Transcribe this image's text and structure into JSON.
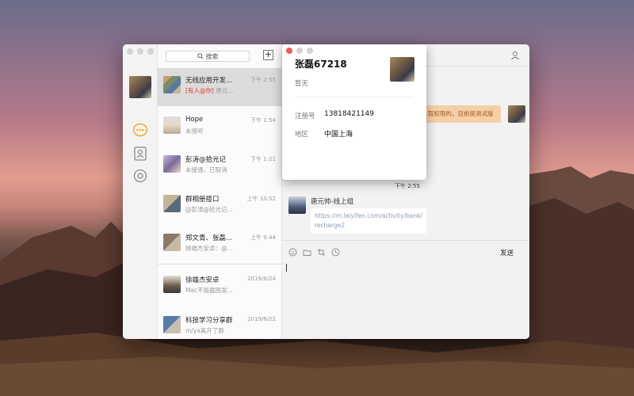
{
  "conversations": {
    "search_placeholder": "搜索",
    "add_label": "+",
    "items": [
      {
        "name": "无线应用开发...",
        "time": "下午 2:55",
        "mention": "[有人@你]",
        "preview": "唐元...",
        "selected": true
      },
      {
        "name": "Hope",
        "time": "下午 1:54",
        "preview": "未接听"
      },
      {
        "name": "彭涛@拾光记",
        "time": "下午 1:21",
        "preview": "未接通，已取消"
      },
      {
        "name": "群相册接口",
        "time": "上午 10:52",
        "preview": "@彭涛@拾光记..."
      },
      {
        "name": "郑文青、张磊...",
        "time": "上午 9:44",
        "preview": "徐雄杰安卓：@..."
      },
      {
        "name": "徐雄杰安卓",
        "time": "2019/6/24",
        "preview": "Mac不能截图发..."
      },
      {
        "name": "科技学习分享群",
        "time": "2019/6/22",
        "preview": "m/ya离开了群"
      }
    ]
  },
  "chat": {
    "orange_bubble": "取权限的，目前是测试版",
    "timestamp": "下午 2:55",
    "sender_name": "唐元帅-线上组",
    "link_text": "https://m.laiyifen.com/activity/bank/recharge2",
    "send_label": "发送"
  },
  "popup": {
    "name": "张磊67218",
    "signature": "暂无",
    "reg_label": "注册号",
    "reg_value": "13818421149",
    "region_label": "地区",
    "region_value": "中国上海"
  }
}
